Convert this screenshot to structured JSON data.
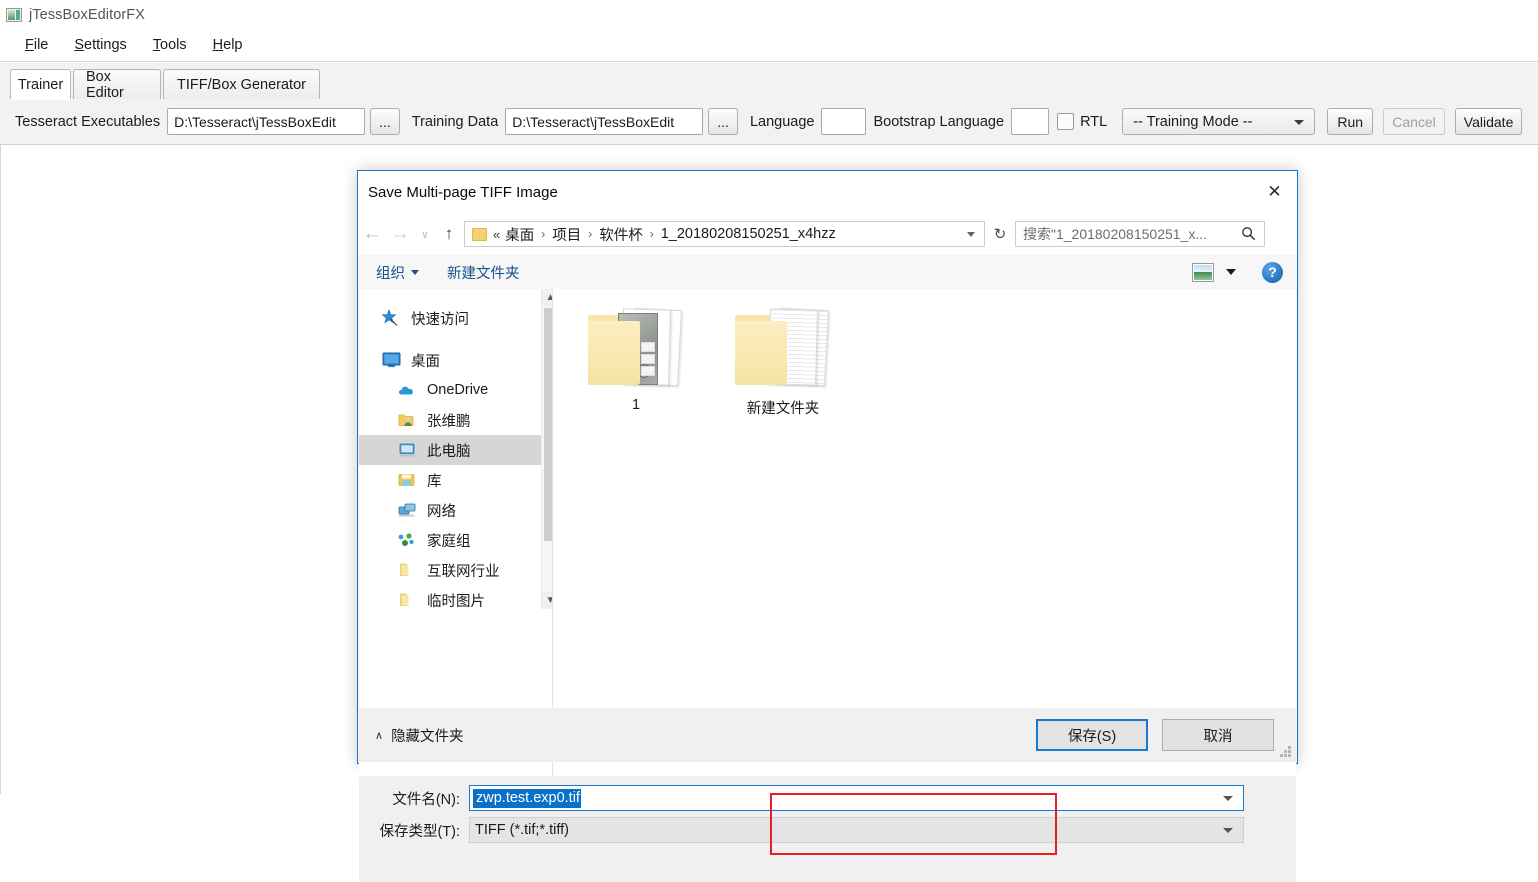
{
  "window": {
    "title": "jTessBoxEditorFX",
    "icon": "app-icon"
  },
  "menu": {
    "items": [
      {
        "label": "File",
        "mnemonic": "F"
      },
      {
        "label": "Settings",
        "mnemonic": "S"
      },
      {
        "label": "Tools",
        "mnemonic": "T"
      },
      {
        "label": "Help",
        "mnemonic": "H"
      }
    ]
  },
  "tabs": [
    {
      "label": "Trainer",
      "active": true
    },
    {
      "label": "Box Editor",
      "active": false
    },
    {
      "label": "TIFF/Box Generator",
      "active": false
    }
  ],
  "toolbar": {
    "tesseract_executables_label": "Tesseract Executables",
    "tesseract_executables_value": "D:\\Tesseract\\jTessBoxEdit",
    "tesseract_browse_label": "...",
    "training_data_label": "Training Data",
    "training_data_value": "D:\\Tesseract\\jTessBoxEdit",
    "training_browse_label": "...",
    "language_label": "Language",
    "language_value": "",
    "bootstrap_language_label": "Bootstrap Language",
    "bootstrap_language_value": "",
    "rtl_label": "RTL",
    "rtl_checked": false,
    "training_mode_value": "-- Training Mode --",
    "run_label": "Run",
    "cancel_label": "Cancel",
    "validate_label": "Validate"
  },
  "dialog": {
    "title": "Save Multi-page TIFF Image",
    "close_label": "✕",
    "nav": {
      "back_label": "←",
      "forward_label": "→",
      "history_label": "∨",
      "up_label": "↑",
      "breadcrumb_prefix": "«",
      "breadcrumb": [
        "桌面",
        "项目",
        "软件杯",
        "1_20180208150251_x4hzz"
      ],
      "breadcrumb_separator": "›",
      "refresh_label": "↻",
      "search_value": "搜索\"1_20180208150251_x...",
      "search_icon": "search-icon"
    },
    "command_bar": {
      "organize_label": "组织",
      "new_folder_label": "新建文件夹",
      "view_icon": "view-layout-icon",
      "help_label": "?"
    },
    "nav_pane": {
      "items": [
        {
          "label": "快速访问",
          "icon": "star-pin-icon",
          "indent": false,
          "selected": false
        },
        {
          "label": "桌面",
          "icon": "desktop-icon",
          "indent": false,
          "selected": false
        },
        {
          "label": "OneDrive",
          "icon": "onedrive-cloud-icon",
          "indent": true,
          "selected": false
        },
        {
          "label": "张维鹏",
          "icon": "user-folder-icon",
          "indent": true,
          "selected": false
        },
        {
          "label": "此电脑",
          "icon": "this-pc-icon",
          "indent": true,
          "selected": true
        },
        {
          "label": "库",
          "icon": "library-icon",
          "indent": true,
          "selected": false
        },
        {
          "label": "网络",
          "icon": "network-icon",
          "indent": true,
          "selected": false
        },
        {
          "label": "家庭组",
          "icon": "homegroup-icon",
          "indent": true,
          "selected": false
        },
        {
          "label": "互联网行业",
          "icon": "folder-icon",
          "indent": true,
          "selected": false
        },
        {
          "label": "临时图片",
          "icon": "folder-icon",
          "indent": true,
          "selected": false
        }
      ]
    },
    "files": [
      {
        "name": "1",
        "type": "folder-with-photo"
      },
      {
        "name": "新建文件夹",
        "type": "folder-with-documents"
      }
    ],
    "form": {
      "filename_label": "文件名(N):",
      "filename_value": "zwp.test.exp0.tif",
      "savetype_label": "保存类型(T):",
      "savetype_value": "TIFF (*.tif;*.tiff)",
      "highlight_color": "#ec1c24",
      "selection_color": "#0a71c8"
    },
    "footer": {
      "hide_folders_label": "隐藏文件夹",
      "hide_folders_caret": "∧",
      "save_label": "保存(S)",
      "cancel_label": "取消"
    }
  }
}
